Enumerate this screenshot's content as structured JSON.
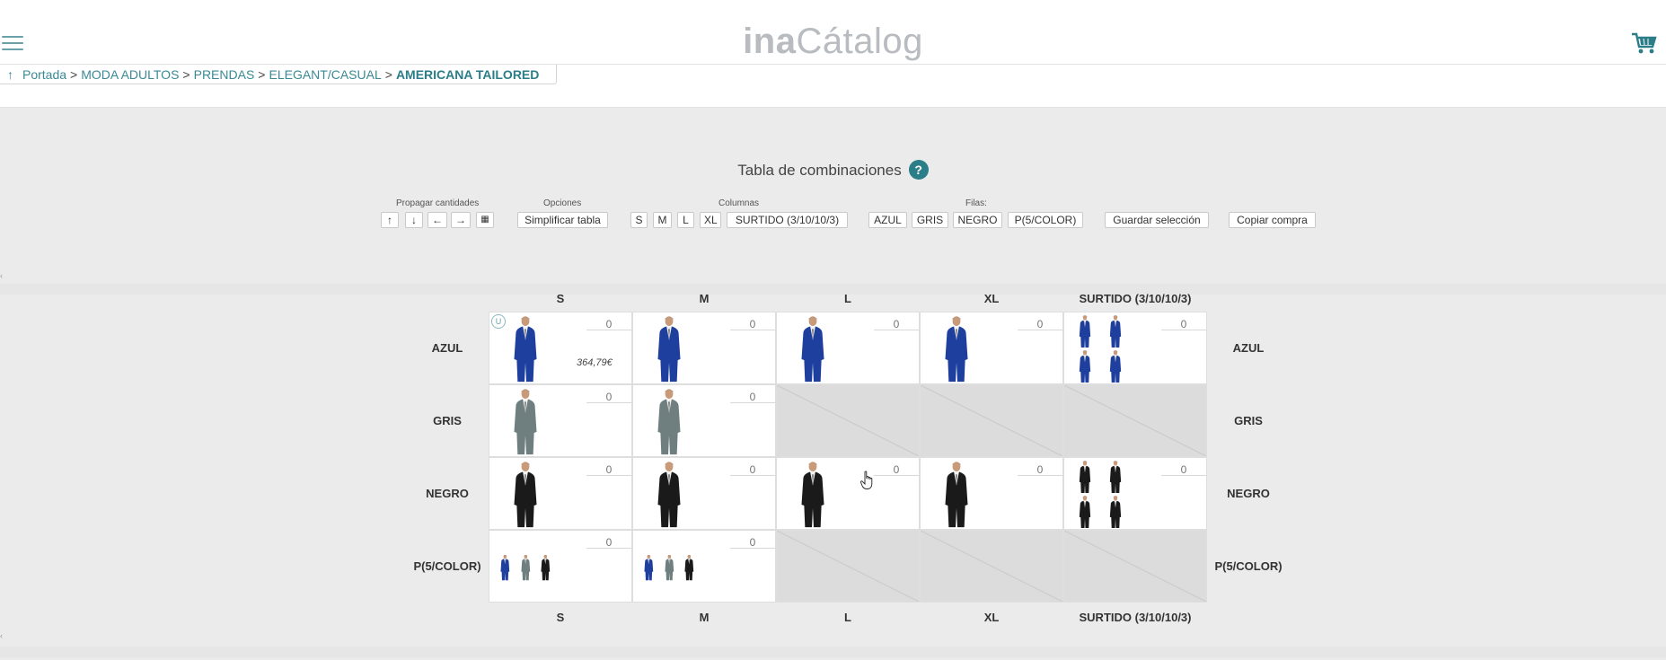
{
  "app": {
    "logo_prefix": "ina",
    "logo_suffix": "Cátalog"
  },
  "icons": {
    "menu": "hamburger-icon",
    "cart": "cart-icon"
  },
  "breadcrumb": {
    "up": "↑",
    "items": [
      "Portada",
      "MODA ADULTOS",
      "PRENDAS",
      "ELEGANT/CASUAL"
    ],
    "separator": ">",
    "current": "AMERICANA TAILORED"
  },
  "table_title": "Tabla de combinaciones",
  "help_label": "?",
  "toolbar": {
    "propagate_label": "Propagar cantidades",
    "propagate_buttons": [
      "↑",
      "↓",
      "←",
      "→",
      "▦"
    ],
    "options_label": "Opciones",
    "simplify_label": "Simplificar tabla",
    "columns_label": "Columnas",
    "column_buttons": [
      "S",
      "M",
      "L",
      "XL",
      "SURTIDO (3/10/10/3)"
    ],
    "rows_label": "Filas:",
    "row_buttons": [
      "AZUL",
      "GRIS",
      "NEGRO",
      "P(5/COLOR)"
    ],
    "save_label": "Guardar selección",
    "copy_label": "Copiar compra"
  },
  "grid": {
    "columns": [
      "S",
      "M",
      "L",
      "XL",
      "SURTIDO (3/10/10/3)"
    ],
    "rows": [
      "AZUL",
      "GRIS",
      "NEGRO",
      "P(5/COLOR)"
    ],
    "available": [
      [
        true,
        true,
        true,
        true,
        true
      ],
      [
        true,
        true,
        false,
        false,
        false
      ],
      [
        true,
        true,
        true,
        true,
        true
      ],
      [
        true,
        true,
        false,
        false,
        false
      ]
    ],
    "quantity": "0",
    "price": "364,79€",
    "badge": "U"
  },
  "colors": {
    "accent": "#2b7d88",
    "link": "#3a8a95",
    "suit_azul": "#1f3f9e",
    "suit_gris": "#6f7f80",
    "suit_negro": "#1a1a1a",
    "background": "#ebebec"
  }
}
